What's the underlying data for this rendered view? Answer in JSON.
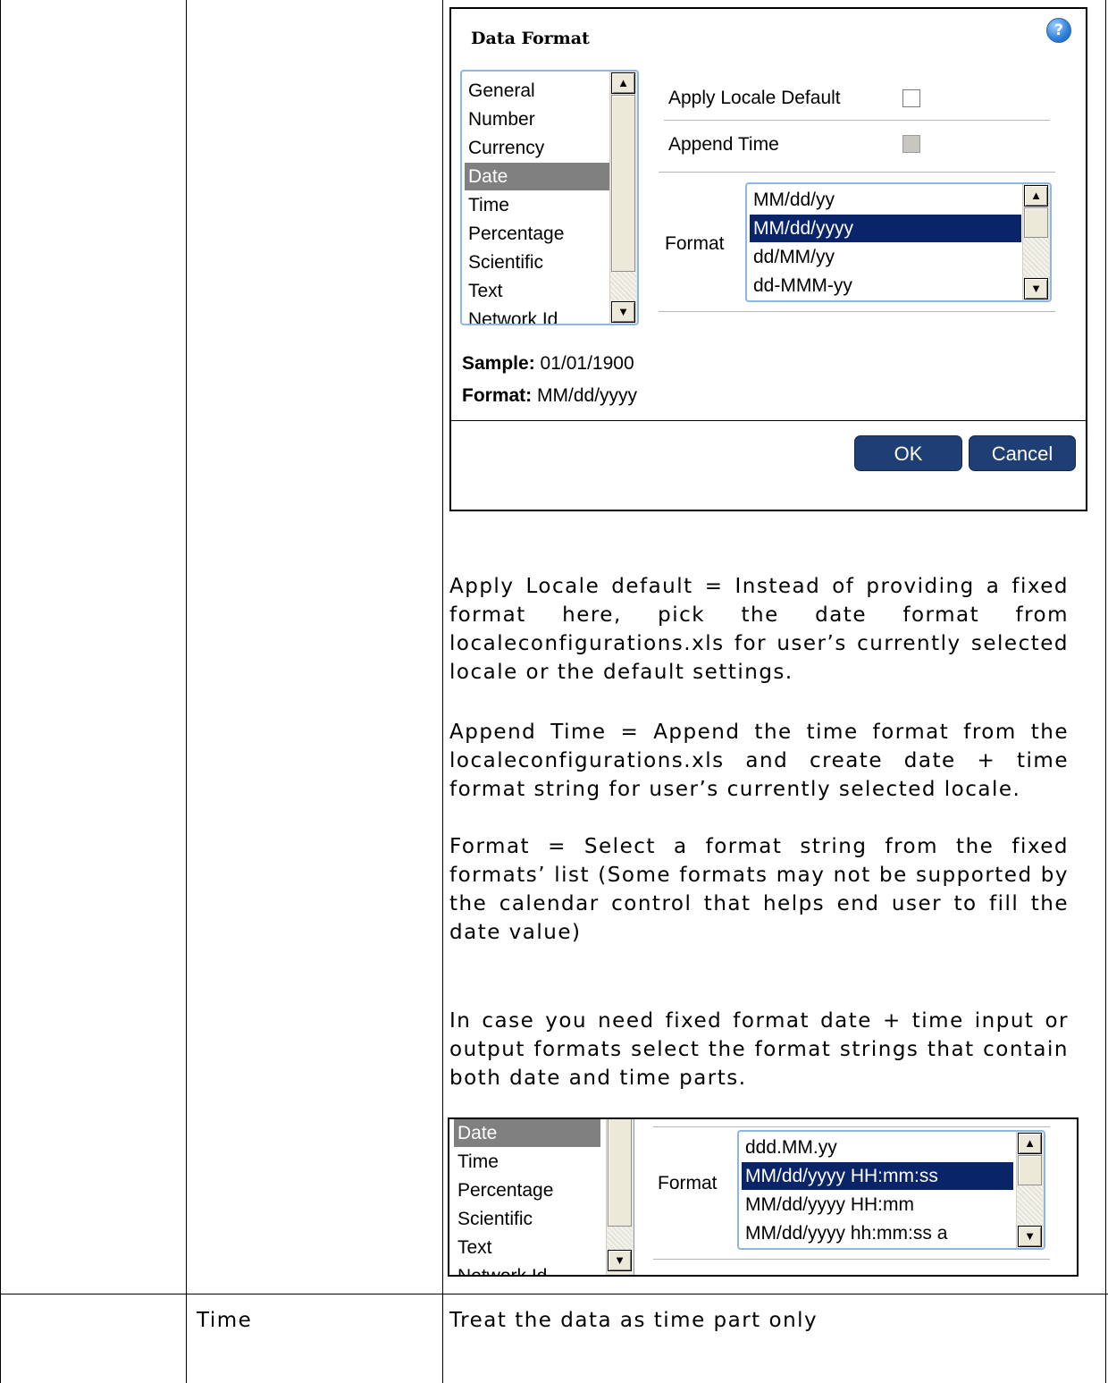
{
  "dialog": {
    "title": "Data Format",
    "help_icon": "?",
    "categories": [
      "General",
      "Number",
      "Currency",
      "Date",
      "Time",
      "Percentage",
      "Scientific",
      "Text",
      "Network Id"
    ],
    "selected_category": "Date",
    "apply_locale_default_label": "Apply Locale Default",
    "append_time_label": "Append Time",
    "format_label": "Format",
    "formats": [
      "MM/dd/yy",
      "MM/dd/yyyy",
      "dd/MM/yy",
      "dd-MMM-yy"
    ],
    "selected_format": "MM/dd/yyyy",
    "sample_label": "Sample:",
    "sample_value": "01/01/1900",
    "format_info_label": "Format:",
    "format_info_value": "MM/dd/yyyy",
    "ok_label": "OK",
    "cancel_label": "Cancel"
  },
  "descriptions": {
    "apply_locale": "Apply Locale default = Instead of providing a fixed format here, pick the date format from localeconfigurations.xls for user’s currently selected locale or the default settings.",
    "append_time": "Append Time = Append the time format from the localeconfigurations.xls and create date + time format string for user’s currently selected locale.",
    "format": "Format = Select a format string from the fixed formats’ list (Some formats may not be supported by the calendar control that helps end user to fill the date value)",
    "date_time": "In case you need fixed format date + time input or output formats select the format strings that contain both date and time parts."
  },
  "snippet": {
    "categories": [
      "Date",
      "Time",
      "Percentage",
      "Scientific",
      "Text",
      "Network Id"
    ],
    "selected_category": "Date",
    "format_label": "Format",
    "formats": [
      "ddd.MM.yy",
      "MM/dd/yyyy HH:mm:ss",
      "MM/dd/yyyy HH:mm",
      "MM/dd/yyyy hh:mm:ss a"
    ],
    "selected_format": "MM/dd/yyyy HH:mm:ss"
  },
  "table_row": {
    "type": "Time",
    "description": "Treat the data as time part only"
  }
}
